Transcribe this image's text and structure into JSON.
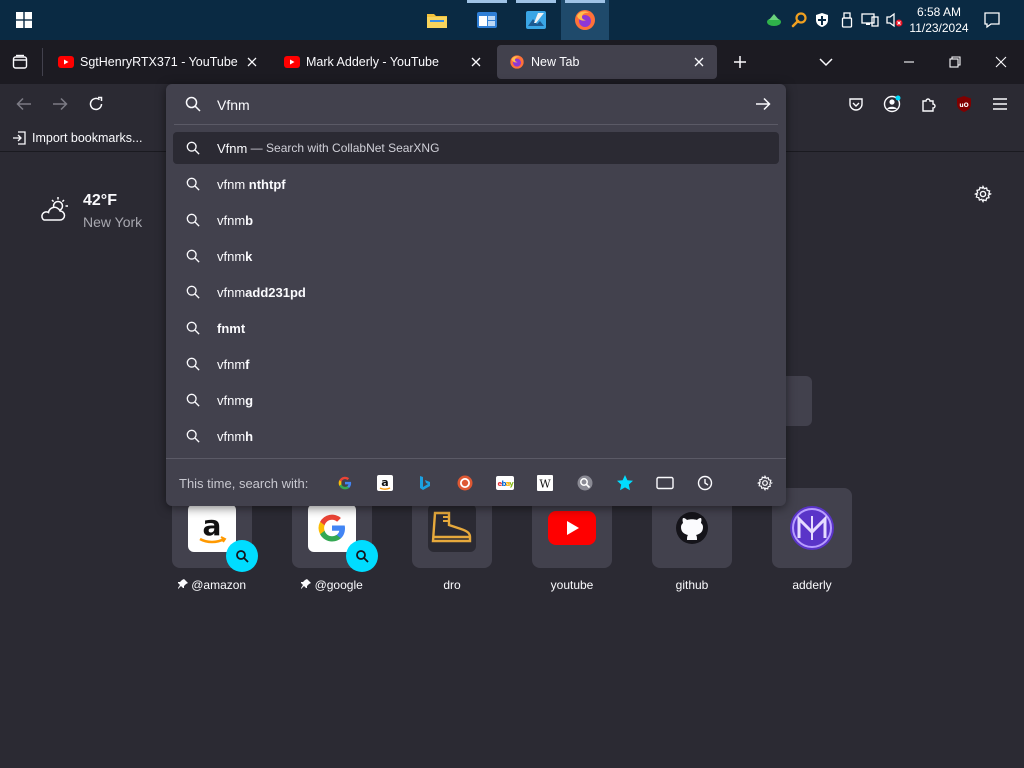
{
  "taskbar": {
    "clock_time": "6:58 AM",
    "clock_date": "11/23/2024",
    "apps": [
      "file-explorer-icon",
      "calendar-app-icon",
      "image-editor-icon",
      "firefox-icon"
    ]
  },
  "tabs": [
    {
      "title": "SgtHenryRTX371 - YouTube",
      "favicon": "youtube-icon"
    },
    {
      "title": "Mark Adderly - YouTube",
      "favicon": "youtube-icon"
    },
    {
      "title": "New Tab",
      "favicon": "firefox-icon",
      "active": true
    }
  ],
  "bookmarks": {
    "import_label": "Import bookmarks..."
  },
  "urlbar": {
    "query": "Vfnm",
    "heuristic": {
      "text": "Vfnm",
      "separator": " — ",
      "action": "Search with CollabNet SearXNG"
    },
    "suggestions": [
      {
        "typed": "vfnm",
        "rest": " nthtpf"
      },
      {
        "typed": "vfnm",
        "rest": "b"
      },
      {
        "typed": "vfnm",
        "rest": "k"
      },
      {
        "typed": "vfnm",
        "rest": "add231pd"
      },
      {
        "typed": "",
        "rest": "fnmt"
      },
      {
        "typed": "vfnm",
        "rest": "f"
      },
      {
        "typed": "vfnm",
        "rest": "g"
      },
      {
        "typed": "vfnm",
        "rest": "h"
      }
    ],
    "search_with_label": "This time, search with:",
    "engines": [
      "google-icon",
      "amazon-icon",
      "bing-icon",
      "duckduckgo-icon",
      "ebay-icon",
      "wikipedia-icon",
      "searxng-icon",
      "bookmarks-star-icon",
      "tabs-icon",
      "history-icon"
    ]
  },
  "weather": {
    "temp": "42°F",
    "location": "New York"
  },
  "top_sites": [
    {
      "label": "@amazon",
      "pinned": true
    },
    {
      "label": "@google",
      "pinned": true
    },
    {
      "label": "dro",
      "pinned": false
    },
    {
      "label": "youtube",
      "pinned": false
    },
    {
      "label": "github",
      "pinned": false
    },
    {
      "label": "adderly",
      "pinned": false
    }
  ],
  "colors": {
    "accent": "#00ddff",
    "taskbar": "#0a2a43",
    "panel": "#42414d"
  }
}
